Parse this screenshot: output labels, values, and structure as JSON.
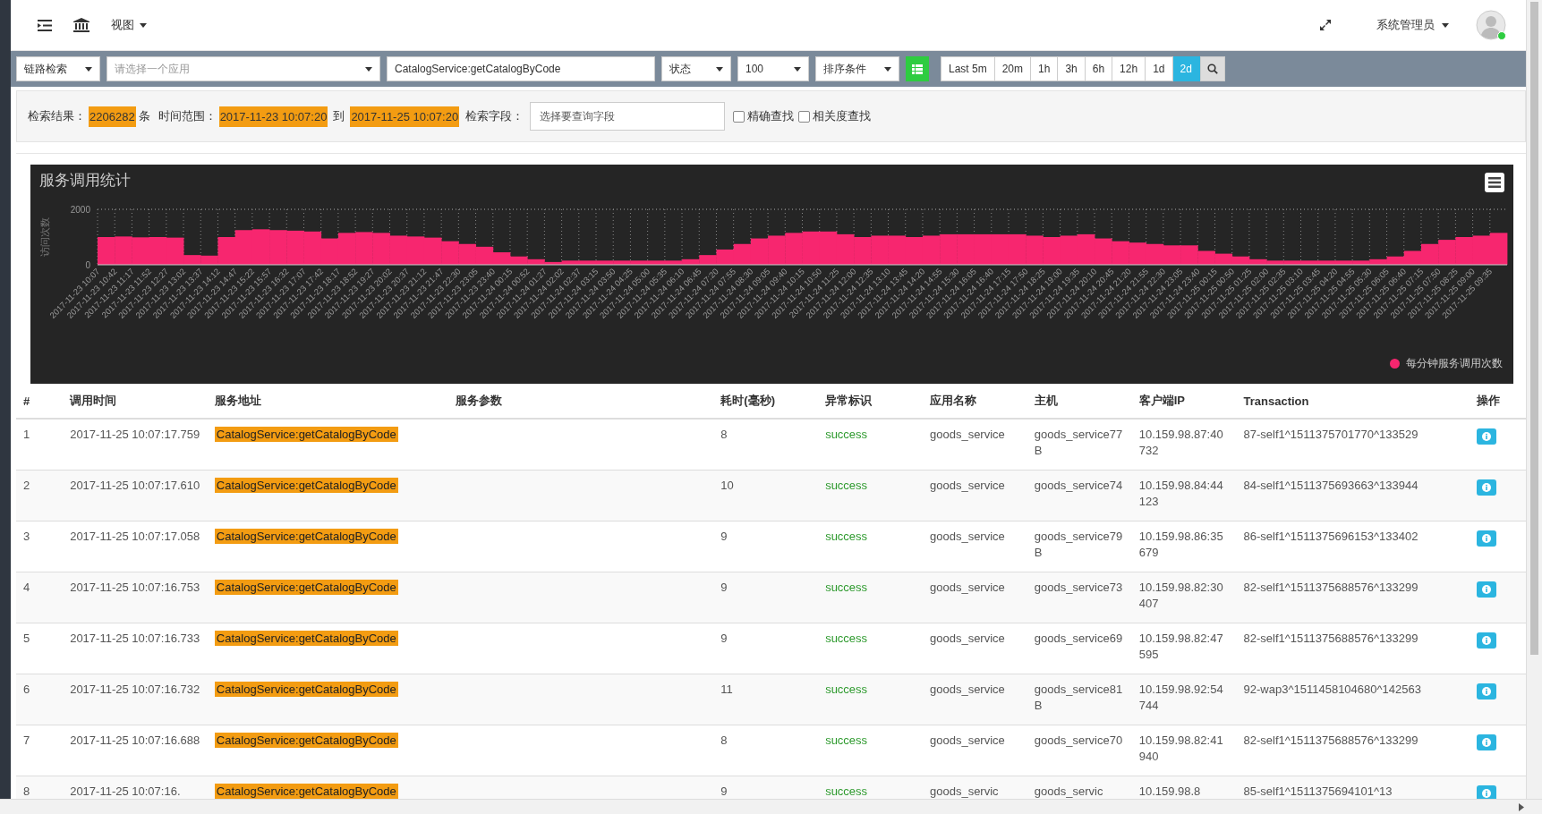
{
  "navbar": {
    "view_menu": "视图",
    "user": "系统管理员"
  },
  "toolbar": {
    "search_type": "链路检索",
    "app_select": {
      "placeholder": "请选择一个应用"
    },
    "service_input": "CatalogService:getCatalogByCode",
    "status_select": "状态",
    "limit_select": "100",
    "sort_select": "排序条件",
    "ranges": [
      {
        "label": "Last 5m",
        "selected": false
      },
      {
        "label": "20m",
        "selected": false
      },
      {
        "label": "1h",
        "selected": false
      },
      {
        "label": "3h",
        "selected": false
      },
      {
        "label": "6h",
        "selected": false
      },
      {
        "label": "12h",
        "selected": false
      },
      {
        "label": "1d",
        "selected": false
      },
      {
        "label": "2d",
        "selected": true
      }
    ]
  },
  "filter": {
    "result_label": "检索结果：",
    "result_count": "2206282",
    "result_unit": "条",
    "range_label": "时间范围：",
    "range_from": "2017-11-23 10:07:20",
    "range_to_label": "到",
    "range_to": "2017-11-25 10:07:20",
    "field_label": "检索字段：",
    "field_input": {
      "placeholder": "选择要查询字段"
    },
    "options": [
      {
        "label": "精确查找",
        "checked": false
      },
      {
        "label": "相关度查找",
        "checked": false
      }
    ]
  },
  "chart": {
    "title": "服务调用统计",
    "chart_data": {
      "type": "bar",
      "grid": true,
      "ylabel": "访问次数",
      "ylim": [
        0,
        2000
      ],
      "yticks": [
        0,
        2000
      ],
      "categories": [
        "2017-11-23 10:07",
        "2017-11-23 10:42",
        "2017-11-23 11:17",
        "2017-11-23 11:52",
        "2017-11-23 12:27",
        "2017-11-23 13:02",
        "2017-11-23 13:37",
        "2017-11-23 14:12",
        "2017-11-23 14:47",
        "2017-11-23 15:22",
        "2017-11-23 15:57",
        "2017-11-23 16:32",
        "2017-11-23 17:07",
        "2017-11-23 17:42",
        "2017-11-23 18:17",
        "2017-11-23 18:52",
        "2017-11-23 19:27",
        "2017-11-23 20:02",
        "2017-11-23 20:37",
        "2017-11-23 21:12",
        "2017-11-23 21:47",
        "2017-11-23 22:30",
        "2017-11-23 23:05",
        "2017-11-23 23:40",
        "2017-11-24 00:15",
        "2017-11-24 00:52",
        "2017-11-24 01:27",
        "2017-11-24 02:02",
        "2017-11-24 02:37",
        "2017-11-24 03:15",
        "2017-11-24 03:50",
        "2017-11-24 04:25",
        "2017-11-24 05:00",
        "2017-11-24 05:35",
        "2017-11-24 06:10",
        "2017-11-24 06:45",
        "2017-11-24 07:20",
        "2017-11-24 07:55",
        "2017-11-24 08:30",
        "2017-11-24 09:05",
        "2017-11-24 09:40",
        "2017-11-24 10:15",
        "2017-11-24 10:50",
        "2017-11-24 11:25",
        "2017-11-24 12:00",
        "2017-11-24 12:35",
        "2017-11-24 13:10",
        "2017-11-24 13:45",
        "2017-11-24 14:20",
        "2017-11-24 14:55",
        "2017-11-24 15:30",
        "2017-11-24 16:05",
        "2017-11-24 16:40",
        "2017-11-24 17:15",
        "2017-11-24 17:50",
        "2017-11-24 18:25",
        "2017-11-24 19:00",
        "2017-11-24 19:35",
        "2017-11-24 20:10",
        "2017-11-24 20:45",
        "2017-11-24 21:20",
        "2017-11-24 21:55",
        "2017-11-24 22:30",
        "2017-11-24 23:05",
        "2017-11-24 23:40",
        "2017-11-25 00:15",
        "2017-11-25 00:50",
        "2017-11-25 01:25",
        "2017-11-25 02:00",
        "2017-11-25 02:35",
        "2017-11-25 03:10",
        "2017-11-25 03:45",
        "2017-11-25 04:20",
        "2017-11-25 04:55",
        "2017-11-25 05:30",
        "2017-11-25 06:05",
        "2017-11-25 06:40",
        "2017-11-25 07:15",
        "2017-11-25 07:50",
        "2017-11-25 08:25",
        "2017-11-25 09:00",
        "2017-11-25 09:35"
      ],
      "series": [
        {
          "name": "每分钟服务调用次数",
          "color": "#f7266f",
          "values": [
            1000,
            1020,
            990,
            1000,
            980,
            350,
            330,
            1000,
            1250,
            1280,
            1250,
            1230,
            1200,
            950,
            1150,
            1180,
            1150,
            1050,
            1020,
            980,
            850,
            750,
            650,
            450,
            300,
            200,
            100,
            150,
            150,
            150,
            150,
            150,
            150,
            150,
            200,
            350,
            550,
            750,
            950,
            1050,
            1150,
            1200,
            1200,
            1100,
            1000,
            1050,
            1050,
            1000,
            1050,
            1100,
            1100,
            1100,
            1100,
            1100,
            1050,
            1000,
            1050,
            1100,
            950,
            850,
            800,
            750,
            700,
            700,
            500,
            400,
            300,
            200,
            150,
            150,
            150,
            150,
            150,
            150,
            200,
            300,
            500,
            750,
            900,
            1000,
            1050,
            1150
          ]
        }
      ]
    }
  },
  "table": {
    "columns": [
      "#",
      "调用时间",
      "服务地址",
      "服务参数",
      "耗时(毫秒)",
      "异常标识",
      "应用名称",
      "主机",
      "客户端IP",
      "Transaction",
      "操作"
    ],
    "rows": [
      {
        "index": "1",
        "time": "2017-11-25 10:07:17.759",
        "service": "CatalogService:getCatalogByCode",
        "duration": "8",
        "status": "success",
        "app": "goods_service",
        "host": "goods_service77B",
        "client_ip": "10.159.98.87:40732",
        "transaction": "87-self1^1511375701770^133529"
      },
      {
        "index": "2",
        "time": "2017-11-25 10:07:17.610",
        "service": "CatalogService:getCatalogByCode",
        "duration": "10",
        "status": "success",
        "app": "goods_service",
        "host": "goods_service74",
        "client_ip": "10.159.98.84:44123",
        "transaction": "84-self1^1511375693663^133944"
      },
      {
        "index": "3",
        "time": "2017-11-25 10:07:17.058",
        "service": "CatalogService:getCatalogByCode",
        "duration": "9",
        "status": "success",
        "app": "goods_service",
        "host": "goods_service79B",
        "client_ip": "10.159.98.86:35679",
        "transaction": "86-self1^1511375696153^133402"
      },
      {
        "index": "4",
        "time": "2017-11-25 10:07:16.753",
        "service": "CatalogService:getCatalogByCode",
        "duration": "9",
        "status": "success",
        "app": "goods_service",
        "host": "goods_service73",
        "client_ip": "10.159.98.82:30407",
        "transaction": "82-self1^1511375688576^133299"
      },
      {
        "index": "5",
        "time": "2017-11-25 10:07:16.733",
        "service": "CatalogService:getCatalogByCode",
        "duration": "9",
        "status": "success",
        "app": "goods_service",
        "host": "goods_service69",
        "client_ip": "10.159.98.82:47595",
        "transaction": "82-self1^1511375688576^133299"
      },
      {
        "index": "6",
        "time": "2017-11-25 10:07:16.732",
        "service": "CatalogService:getCatalogByCode",
        "duration": "11",
        "status": "success",
        "app": "goods_service",
        "host": "goods_service81B",
        "client_ip": "10.159.98.92:54744",
        "transaction": "92-wap3^1511458104680^142563"
      },
      {
        "index": "7",
        "time": "2017-11-25 10:07:16.688",
        "service": "CatalogService:getCatalogByCode",
        "duration": "8",
        "status": "success",
        "app": "goods_service",
        "host": "goods_service70",
        "client_ip": "10.159.98.82:41940",
        "transaction": "82-self1^1511375688576^133299"
      },
      {
        "index": "8",
        "time": "2017-11-25 10:07:16.",
        "service": "CatalogService:getCatalogByCode",
        "duration": "9",
        "status": "success",
        "app": "goods_servic",
        "host": "goods_servic",
        "client_ip": "10.159.98.8",
        "transaction": "85-self1^1511375694101^13"
      }
    ]
  }
}
